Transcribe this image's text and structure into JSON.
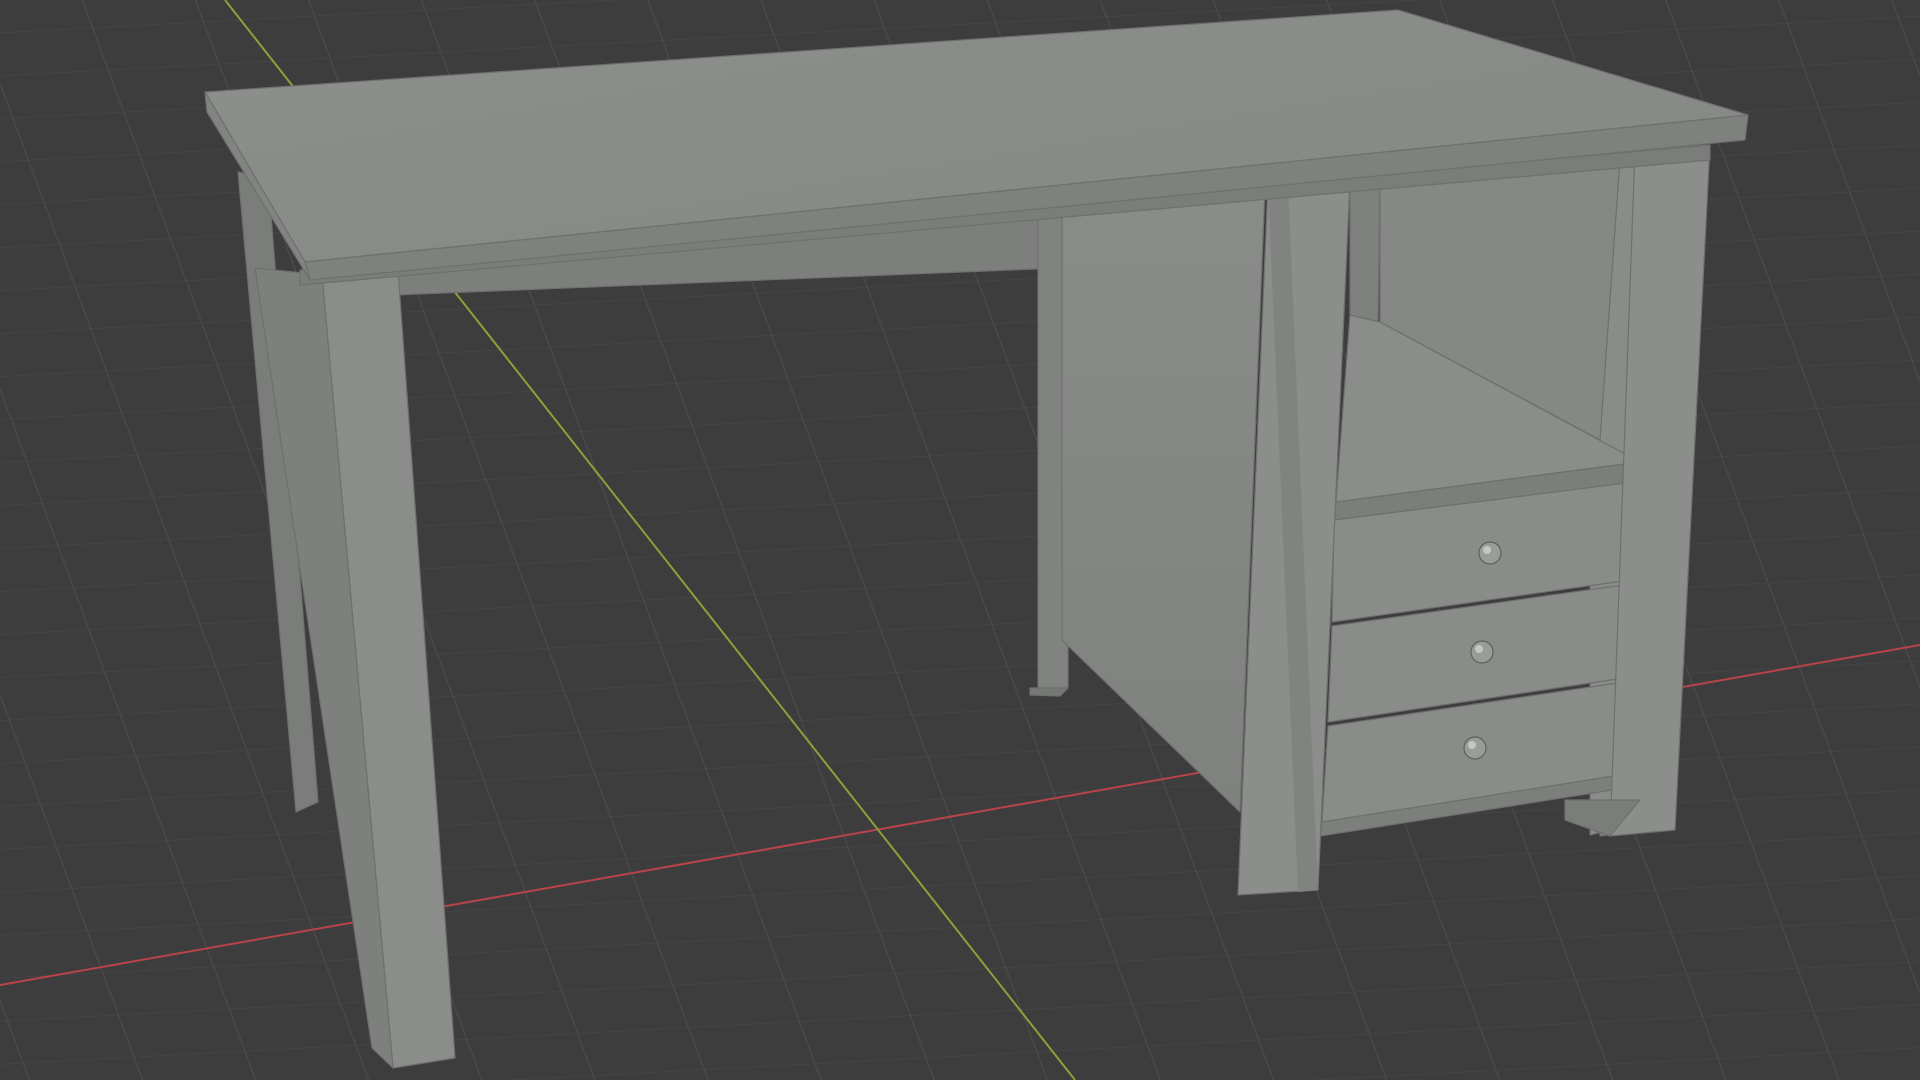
{
  "viewport": {
    "mode": "3D viewport",
    "shading": "solid",
    "grid_visible": true,
    "background_color": "#3d3d3d",
    "grid_line_color": "#4d4d4d",
    "x_axis_color": "#c0444a",
    "y_axis_color": "#8ca43a"
  },
  "model": {
    "object": "desk",
    "base_color": "#8c8e8c",
    "drawers": 3,
    "open_shelf": true
  }
}
